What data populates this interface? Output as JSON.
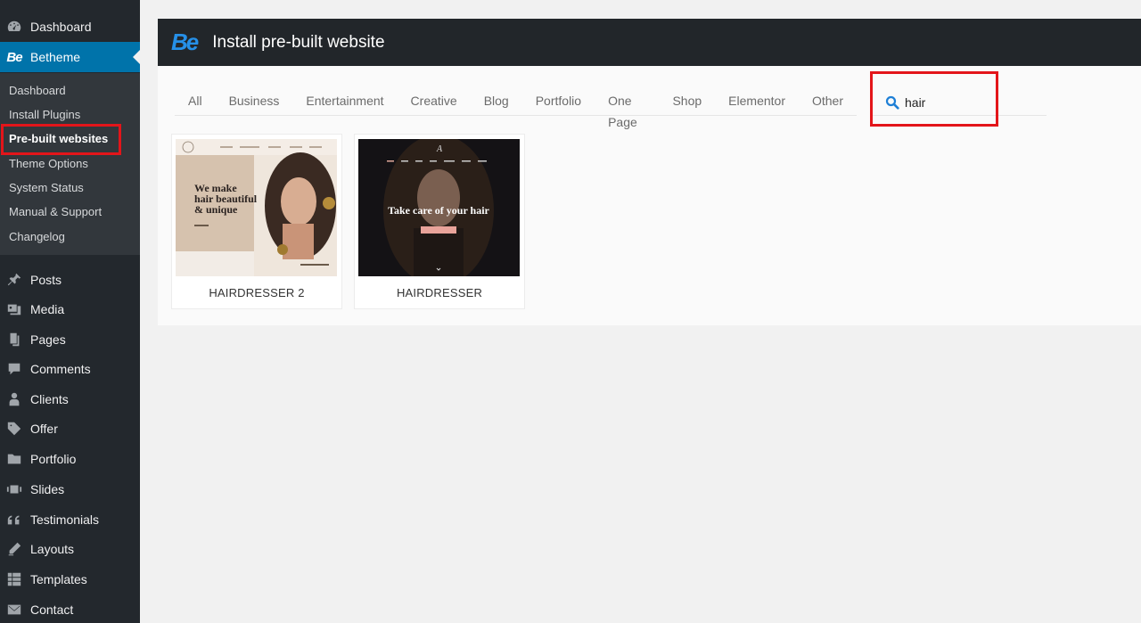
{
  "sidebar": {
    "top_items": [
      {
        "label": "Dashboard",
        "icon": "dashboard-icon"
      },
      {
        "label": "Betheme",
        "icon": "betheme-logo-icon",
        "logo_text": "Be"
      }
    ],
    "submenu": [
      {
        "label": "Dashboard"
      },
      {
        "label": "Install Plugins"
      },
      {
        "label": "Pre-built websites"
      },
      {
        "label": "Theme Options"
      },
      {
        "label": "System Status"
      },
      {
        "label": "Manual & Support"
      },
      {
        "label": "Changelog"
      }
    ],
    "bottom_items": [
      {
        "label": "Posts",
        "icon": "pin-icon"
      },
      {
        "label": "Media",
        "icon": "media-icon"
      },
      {
        "label": "Pages",
        "icon": "pages-icon"
      },
      {
        "label": "Comments",
        "icon": "comment-icon"
      },
      {
        "label": "Clients",
        "icon": "user-icon"
      },
      {
        "label": "Offer",
        "icon": "tag-icon"
      },
      {
        "label": "Portfolio",
        "icon": "folder-icon"
      },
      {
        "label": "Slides",
        "icon": "slides-icon"
      },
      {
        "label": "Testimonials",
        "icon": "quote-icon"
      },
      {
        "label": "Layouts",
        "icon": "pencil-icon"
      },
      {
        "label": "Templates",
        "icon": "grid-icon"
      },
      {
        "label": "Contact",
        "icon": "mail-icon"
      }
    ]
  },
  "panel": {
    "logo": "Be",
    "title": "Install pre-built website",
    "filters": [
      "All",
      "Business",
      "Entertainment",
      "Creative",
      "Blog",
      "Portfolio",
      "One Page",
      "Shop",
      "Elementor",
      "Other"
    ],
    "search": {
      "value": "hair",
      "placeholder": ""
    },
    "cards": [
      {
        "name": "HAIRDRESSER 2",
        "headline": "We make hair beautiful & unique"
      },
      {
        "name": "HAIRDRESSER",
        "headline": "Take care of your hair"
      }
    ]
  },
  "colors": {
    "sidebar_bg": "#23282d",
    "submenu_bg": "#32373c",
    "active": "#0073aa",
    "highlight": "#e3151a",
    "brand_blue": "#2690e8"
  }
}
